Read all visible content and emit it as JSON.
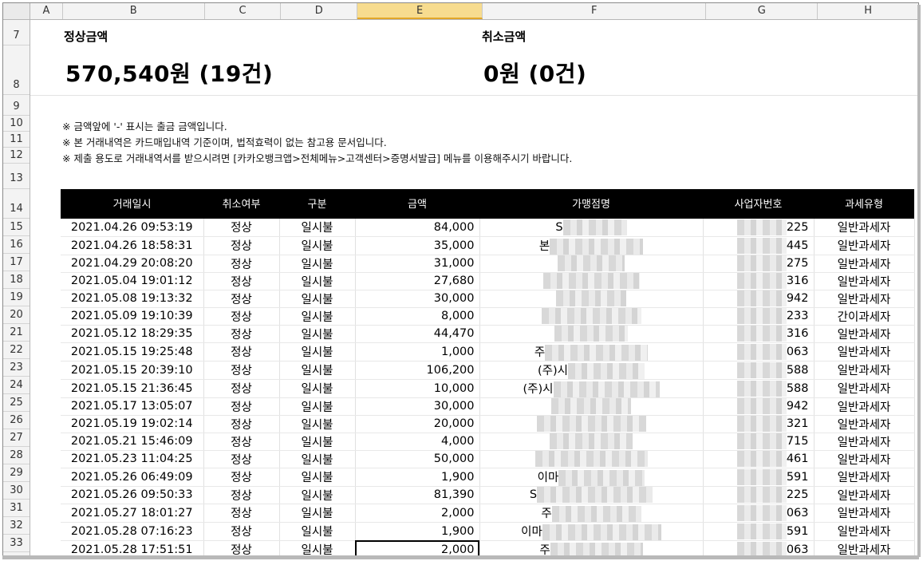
{
  "columns": [
    "A",
    "B",
    "C",
    "D",
    "E",
    "F",
    "G",
    "H"
  ],
  "active_column": "E",
  "rows": [
    "7",
    "8",
    "9",
    "10",
    "11",
    "12",
    "13",
    "14",
    "15",
    "16",
    "17",
    "18",
    "19",
    "20",
    "21",
    "22",
    "23",
    "24",
    "25",
    "26",
    "27",
    "28",
    "29",
    "30",
    "31",
    "32",
    "33"
  ],
  "summary": {
    "normal_label": "정상금액",
    "normal_value": "570,540원 (19건)",
    "cancel_label": "취소금액",
    "cancel_value": "0원 (0건)"
  },
  "notes": [
    "※ 금액앞에 '-' 표시는 출금 금액입니다.",
    "※ 본 거래내역은 카드매입내역 기준이며, 법적효력이 없는 참고용 문서입니다.",
    "※ 제출 용도로 거래내역서를 받으시려면 [카카오뱅크앱>전체메뉴>고객센터>증명서발급] 메뉴를 이용해주시기 바랍니다."
  ],
  "table": {
    "headers": [
      "거래일시",
      "취소여부",
      "구분",
      "금액",
      "가맹점명",
      "사업자번호",
      "과세유형"
    ],
    "rows": [
      {
        "date": "2021.04.26 09:53:19",
        "status": "정상",
        "type": "일시불",
        "amount": "84,000",
        "merchant": "S",
        "bizno": "225",
        "tax": "일반과세자"
      },
      {
        "date": "2021.04.26 18:58:31",
        "status": "정상",
        "type": "일시불",
        "amount": "35,000",
        "merchant": "본",
        "bizno": "445",
        "tax": "일반과세자"
      },
      {
        "date": "2021.04.29 20:08:20",
        "status": "정상",
        "type": "일시불",
        "amount": "31,000",
        "merchant": "",
        "bizno": "275",
        "tax": "일반과세자"
      },
      {
        "date": "2021.05.04 19:01:12",
        "status": "정상",
        "type": "일시불",
        "amount": "27,680",
        "merchant": "",
        "bizno": "316",
        "tax": "일반과세자"
      },
      {
        "date": "2021.05.08 19:13:32",
        "status": "정상",
        "type": "일시불",
        "amount": "30,000",
        "merchant": "",
        "bizno": "942",
        "tax": "일반과세자"
      },
      {
        "date": "2021.05.09 19:10:39",
        "status": "정상",
        "type": "일시불",
        "amount": "8,000",
        "merchant": "",
        "bizno": "233",
        "tax": "간이과세자"
      },
      {
        "date": "2021.05.12 18:29:35",
        "status": "정상",
        "type": "일시불",
        "amount": "44,470",
        "merchant": "",
        "bizno": "316",
        "tax": "일반과세자"
      },
      {
        "date": "2021.05.15 19:25:48",
        "status": "정상",
        "type": "일시불",
        "amount": "1,000",
        "merchant": "주",
        "bizno": "063",
        "tax": "일반과세자"
      },
      {
        "date": "2021.05.15 20:39:10",
        "status": "정상",
        "type": "일시불",
        "amount": "106,200",
        "merchant": "(주)시",
        "bizno": "588",
        "tax": "일반과세자"
      },
      {
        "date": "2021.05.15 21:36:45",
        "status": "정상",
        "type": "일시불",
        "amount": "10,000",
        "merchant": "(주)시",
        "bizno": "588",
        "tax": "일반과세자"
      },
      {
        "date": "2021.05.17 13:05:07",
        "status": "정상",
        "type": "일시불",
        "amount": "30,000",
        "merchant": "",
        "bizno": "942",
        "tax": "일반과세자"
      },
      {
        "date": "2021.05.19 19:02:14",
        "status": "정상",
        "type": "일시불",
        "amount": "20,000",
        "merchant": "",
        "bizno": "321",
        "tax": "일반과세자"
      },
      {
        "date": "2021.05.21 15:46:09",
        "status": "정상",
        "type": "일시불",
        "amount": "4,000",
        "merchant": "",
        "bizno": "715",
        "tax": "일반과세자"
      },
      {
        "date": "2021.05.23 11:04:25",
        "status": "정상",
        "type": "일시불",
        "amount": "50,000",
        "merchant": "",
        "bizno": "461",
        "tax": "일반과세자"
      },
      {
        "date": "2021.05.26 06:49:09",
        "status": "정상",
        "type": "일시불",
        "amount": "1,900",
        "merchant": "이마",
        "bizno": "591",
        "tax": "일반과세자"
      },
      {
        "date": "2021.05.26 09:50:33",
        "status": "정상",
        "type": "일시불",
        "amount": "81,390",
        "merchant": "S",
        "bizno": "225",
        "tax": "일반과세자"
      },
      {
        "date": "2021.05.27 18:01:27",
        "status": "정상",
        "type": "일시불",
        "amount": "2,000",
        "merchant": "주",
        "bizno": "063",
        "tax": "일반과세자"
      },
      {
        "date": "2021.05.28 07:16:23",
        "status": "정상",
        "type": "일시불",
        "amount": "1,900",
        "merchant": "이마",
        "bizno": "591",
        "tax": "일반과세자"
      },
      {
        "date": "2021.05.28 17:51:51",
        "status": "정상",
        "type": "일시불",
        "amount": "2,000",
        "merchant": "주",
        "bizno": "063",
        "tax": "일반과세자"
      }
    ]
  }
}
